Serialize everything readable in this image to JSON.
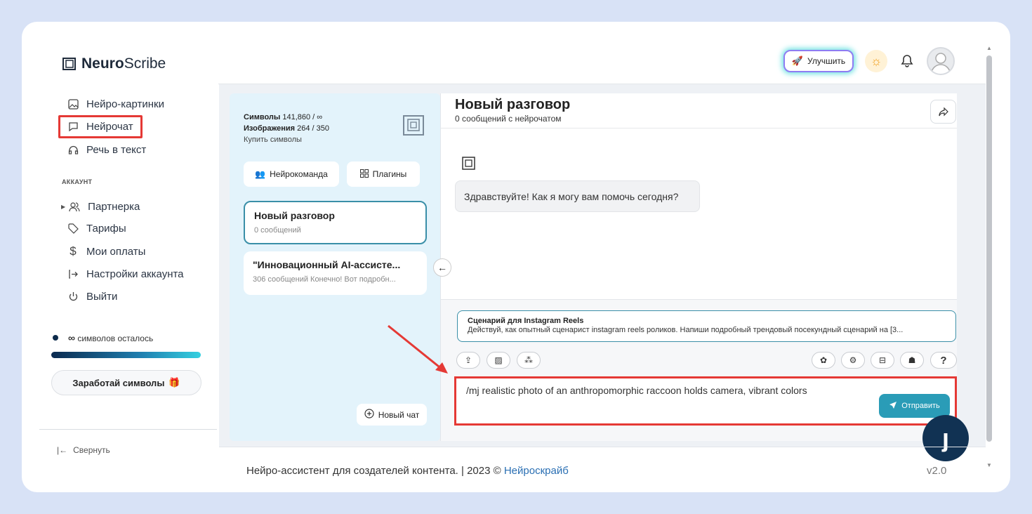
{
  "header": {
    "logo_bold": "Neuro",
    "logo_rest": "Scribe",
    "upgrade_label": "Улучшить"
  },
  "sidebar": {
    "items_top": [
      {
        "label": "Нейро-картинки",
        "icon": "image-icon"
      },
      {
        "label": "Нейрочат",
        "icon": "chat-icon"
      },
      {
        "label": "Речь в текст",
        "icon": "headphones-icon"
      }
    ],
    "section_account": "АККАУНТ",
    "items_account": [
      {
        "label": "Партнерка",
        "icon": "users-icon"
      },
      {
        "label": "Тарифы",
        "icon": "tag-icon"
      },
      {
        "label": "Мои оплаты",
        "icon": "dollar-icon"
      },
      {
        "label": "Настройки аккаунта",
        "icon": "login-icon"
      },
      {
        "label": "Выйти",
        "icon": "power-icon"
      }
    ],
    "symbols_infinity": "∞",
    "symbols_left": "символов осталось",
    "earn_label": "Заработай символы",
    "collapse_label": "Свернуть"
  },
  "conversations": {
    "symbols_label": "Символы",
    "symbols_value": "141,860 / ∞",
    "images_label": "Изображения",
    "images_value": "264 / 350",
    "buy_label": "Купить символы",
    "team_label": "Нейрокоманда",
    "plugins_label": "Плагины",
    "list": [
      {
        "title": "Новый разговор",
        "subtitle": "0 сообщений"
      },
      {
        "title": "\"Инновационный AI-ассисте...",
        "subtitle": "306 сообщений  Конечно! Вот подробн..."
      }
    ],
    "new_chat_label": "Новый чат"
  },
  "chat": {
    "title": "Новый разговор",
    "subtitle": "0 сообщений с нейрочатом",
    "greeting": "Здравствуйте! Как я могу вам помочь сегодня?",
    "prompt_title": "Сценарий для Instagram Reels",
    "prompt_desc": "Действуй, как опытный сценарист instagram reels роликов. Напиши подробный трендовый посекундный сценарий на [3...",
    "input_value": "/mj realistic photo of an anthropomorphic raccoon holds camera, vibrant colors",
    "send_label": "Отправить",
    "help_label": "?"
  },
  "footer": {
    "text": "Нейро-ассистент для создателей контента.  | 2023 © ",
    "link": "Нейроскрайб",
    "version": "v2.0"
  },
  "colors": {
    "background": "#d8e2f6",
    "accent": "#2a9cb7",
    "annotation": "#e53935",
    "panel": "#e3f3fb",
    "chat_bot": "#113253"
  }
}
